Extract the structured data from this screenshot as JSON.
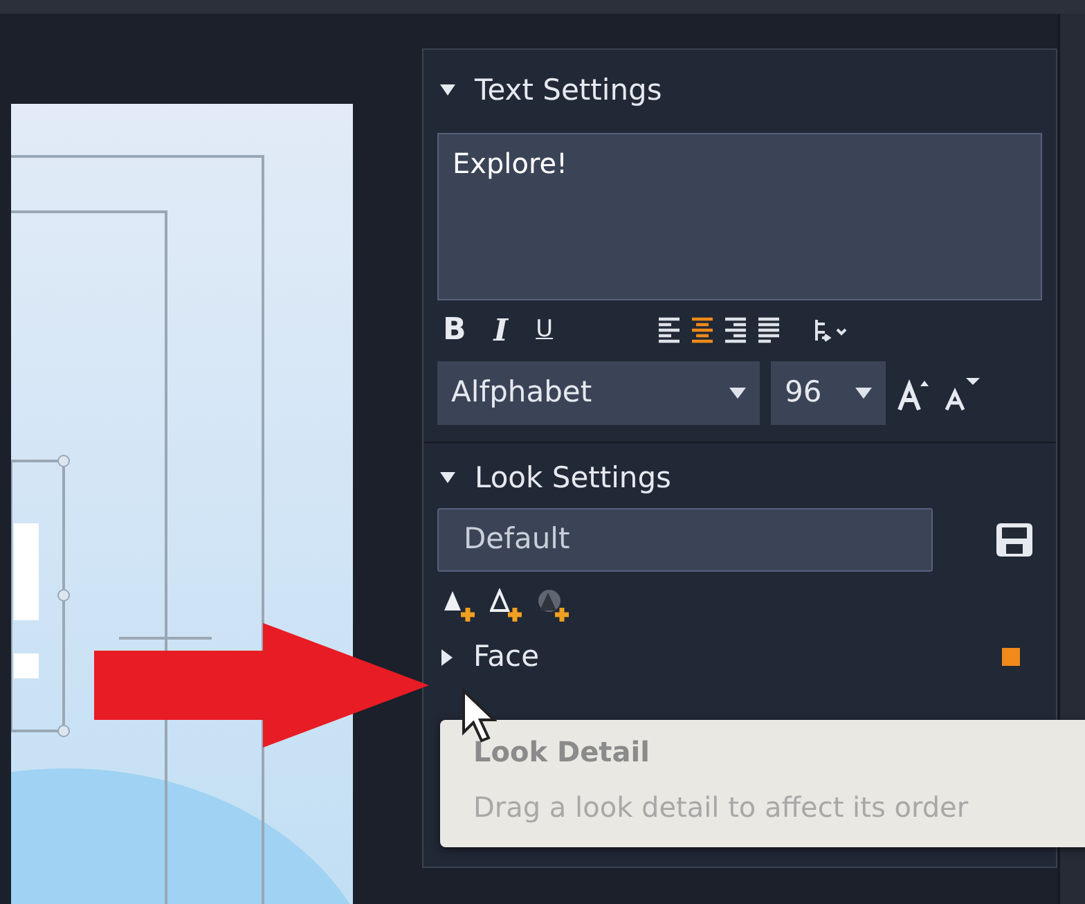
{
  "text_settings": {
    "title": "Text Settings",
    "expanded": true,
    "text": "Explore!",
    "styles": [
      {
        "kind": "bold",
        "label": "B"
      },
      {
        "kind": "italic",
        "label": "I"
      },
      {
        "kind": "underline",
        "label": "U"
      }
    ],
    "alignments": [
      {
        "kind": "left",
        "selected": false
      },
      {
        "kind": "center",
        "selected": true
      },
      {
        "kind": "right",
        "selected": false
      },
      {
        "kind": "justify",
        "selected": false
      }
    ],
    "font": "Alfphabet",
    "size": "96"
  },
  "look_settings": {
    "title": "Look Settings",
    "expanded": true,
    "preset": "Default",
    "details": [
      {
        "label": "Face",
        "expanded": false,
        "color": "#f08a1a"
      }
    ]
  },
  "tooltip": {
    "title": "Look Detail",
    "text": "Drag a look detail to affect its order"
  }
}
